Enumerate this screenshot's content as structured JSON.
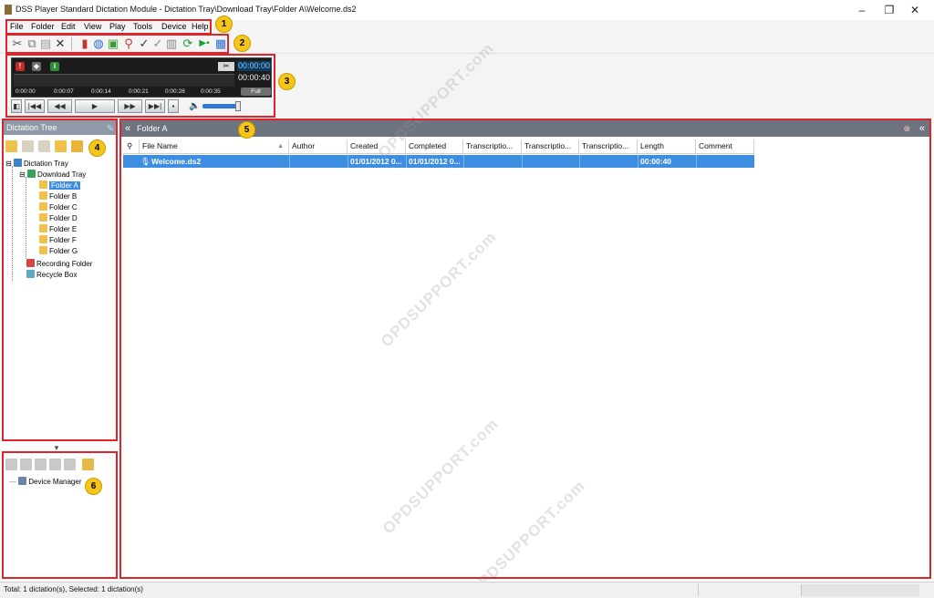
{
  "window": {
    "title": "DSS Player Standard Dictation Module - Dictation Tray\\Download Tray\\Folder A\\Welcome.ds2",
    "minimize": "–",
    "maximize": "❐",
    "close": "✕"
  },
  "menu": [
    "File",
    "Folder",
    "Edit",
    "View",
    "Play",
    "Tools",
    "Device",
    "Help"
  ],
  "callouts": [
    "1",
    "2",
    "3",
    "4",
    "5",
    "6"
  ],
  "player": {
    "position_time": "00:00:00",
    "length_time": "00:00:40",
    "speed_mode": "Full",
    "scale_ticks": [
      "0:00:00",
      "0:00:07",
      "0:00:14",
      "0:00:21",
      "0:00:28",
      "0:00:35"
    ],
    "volume_level": 0.95
  },
  "dictation_tree": {
    "header": "Dictation Tree",
    "items": {
      "tray": "Dictation Tray",
      "download": "Download Tray",
      "folder_a": "Folder A",
      "folder_b": "Folder B",
      "folder_c": "Folder C",
      "folder_d": "Folder D",
      "folder_e": "Folder E",
      "folder_f": "Folder F",
      "folder_g": "Folder G",
      "recording": "Recording Folder",
      "recycle": "Recycle Box"
    },
    "collapse_arrow": "▼"
  },
  "device_tree": {
    "device_manager": "Device Manager"
  },
  "main": {
    "header": "Folder A",
    "collapse_left": "«",
    "collapse_right": "«",
    "columns": [
      "File Name",
      "Author",
      "Created",
      "Completed",
      "Transcriptio...",
      "Transcriptio...",
      "Transcriptio...",
      "Length",
      "Comment"
    ],
    "rows": [
      {
        "file_name": "Welcome.ds2",
        "author": "",
        "created": "01/01/2012 0...",
        "completed": "01/01/2012 0...",
        "t1": "",
        "t2": "",
        "t3": "",
        "length": "00:00:40",
        "comment": ""
      }
    ]
  },
  "status": {
    "text": "Total: 1 dictation(s), Selected: 1 dictation(s)"
  },
  "watermark": "OPDSUPPORT.com",
  "colors": {
    "callout_red": "#e0242c",
    "badge_yellow": "#f5c518",
    "selection_blue": "#3d8de0",
    "header_gray": "#8f9aa6"
  }
}
